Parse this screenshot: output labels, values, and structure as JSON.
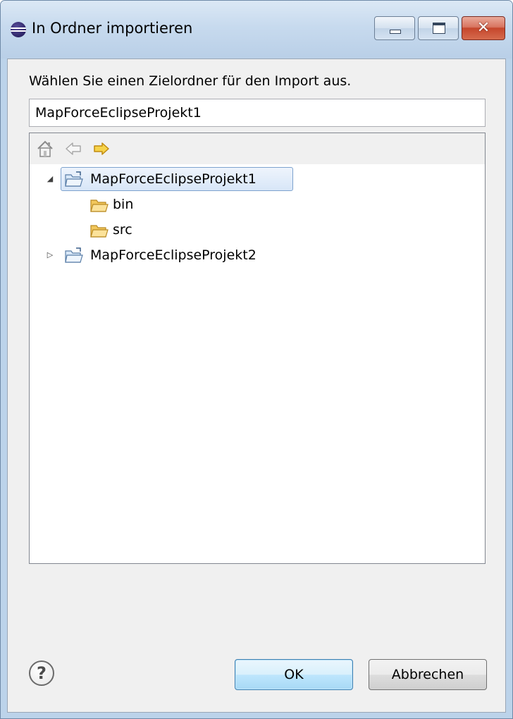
{
  "window": {
    "title": "In Ordner importieren",
    "icon": "eclipse-icon",
    "caption_buttons": [
      "minimize-icon",
      "maximize-icon",
      "close-icon"
    ],
    "close_glyph": "✕"
  },
  "dialog": {
    "prompt": "Wählen Sie einen Zielordner für den Import aus.",
    "path_value": "MapForceEclipseProjekt1",
    "toolbar": {
      "icons": [
        "home-icon",
        "back-arrow-icon",
        "forward-arrow-icon"
      ],
      "back_enabled": false,
      "forward_enabled": true
    },
    "tree": [
      {
        "label": "MapForceEclipseProjekt1",
        "expanded": true,
        "selected": true,
        "twisty": "◢",
        "children": [
          {
            "label": "bin"
          },
          {
            "label": "src"
          }
        ]
      },
      {
        "label": "MapForceEclipseProjekt2",
        "expanded": false,
        "selected": false,
        "twisty": "▷"
      }
    ],
    "help_glyph": "?",
    "ok_label": "OK",
    "cancel_label": "Abbrechen"
  },
  "colors": {
    "frame": "#bcd3ea",
    "selection_border": "#7da2ce",
    "close_button": "#c5462c",
    "folder": "#f2c75c"
  }
}
